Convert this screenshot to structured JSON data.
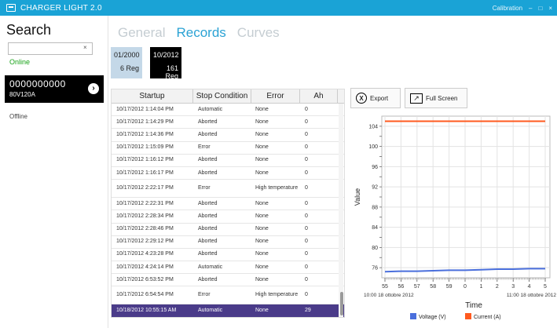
{
  "window": {
    "title": "CHARGER LIGHT 2.0",
    "right_label": "Calibration",
    "minimize": "–",
    "maximize": "□",
    "close": "×"
  },
  "sidebar": {
    "search_title": "Search",
    "search_value": "",
    "clear_glyph": "×",
    "online_label": "Online",
    "device": {
      "serial": "0000000000",
      "model": "80V120A",
      "arrow_glyph": "›"
    },
    "offline_label": "Offline"
  },
  "tabs": [
    {
      "label": "General",
      "active": false
    },
    {
      "label": "Records",
      "active": true
    },
    {
      "label": "Curves",
      "active": false
    }
  ],
  "registers": [
    {
      "date": "01/2000",
      "count": "6 Reg"
    },
    {
      "date": "10/2012",
      "count": "161 Reg"
    }
  ],
  "table": {
    "headers": [
      "Startup",
      "Stop Condition",
      "Error",
      "Ah"
    ],
    "rows": [
      [
        "10/17/2012 1:14:04 PM",
        "Automatic",
        "None",
        "0"
      ],
      [
        "10/17/2012 1:14:29 PM",
        "Aborted",
        "None",
        "0"
      ],
      [
        "10/17/2012 1:14:36 PM",
        "Aborted",
        "None",
        "0"
      ],
      [
        "10/17/2012 1:15:09 PM",
        "Error",
        "None",
        "0"
      ],
      [
        "10/17/2012 1:16:12 PM",
        "Aborted",
        "None",
        "0"
      ],
      [
        "10/17/2012 1:16:17 PM",
        "Aborted",
        "None",
        "0"
      ],
      [
        "10/17/2012 2:22:17 PM",
        "Error",
        "High temperature",
        "0"
      ],
      [
        "10/17/2012 2:22:31 PM",
        "Aborted",
        "None",
        "0"
      ],
      [
        "10/17/2012 2:28:34 PM",
        "Aborted",
        "None",
        "0"
      ],
      [
        "10/17/2012 2:28:46 PM",
        "Aborted",
        "None",
        "0"
      ],
      [
        "10/17/2012 2:29:12 PM",
        "Aborted",
        "None",
        "0"
      ],
      [
        "10/17/2012 4:23:28 PM",
        "Aborted",
        "None",
        "0"
      ],
      [
        "10/17/2012 4:24:14 PM",
        "Automatic",
        "None",
        "0"
      ],
      [
        "10/17/2012 6:53:52 PM",
        "Aborted",
        "None",
        "0"
      ],
      [
        "10/17/2012 6:54:54 PM",
        "Error",
        "High temperature",
        "0"
      ],
      [
        "10/18/2012 10:55:15 AM",
        "Automatic",
        "None",
        "29"
      ]
    ],
    "selected_index": 15
  },
  "buttons": {
    "export": "Export",
    "export_icon": "excel-icon",
    "full_screen": "Full Screen",
    "full_icon": "expand-icon"
  },
  "chart_data": {
    "type": "line",
    "xlabel": "Time",
    "ylabel": "Value",
    "ylim": [
      74,
      106
    ],
    "y_ticks": [
      76,
      78,
      80,
      82,
      84,
      86,
      88,
      90,
      92,
      94,
      96,
      98,
      100,
      102,
      104
    ],
    "y_tick_labels": [
      "76",
      "78",
      "80",
      "82",
      "84",
      "86",
      "88",
      "90",
      "92",
      "94",
      "96",
      "98",
      "100",
      "102",
      "104"
    ],
    "x_tick_labels": [
      "55",
      "56",
      "57",
      "58",
      "59",
      "0",
      "1",
      "2",
      "3",
      "4",
      "5"
    ],
    "x_date_labels": [
      "10:00 18 ottobre 2012",
      "11:00 18 ottobre 2012"
    ],
    "grid": true,
    "legend_position": "bottom",
    "series": [
      {
        "name": "Voltage (V)",
        "color": "#4a6fdc",
        "values": [
          75.2,
          75.3,
          75.3,
          75.4,
          75.5,
          75.5,
          75.6,
          75.7,
          75.7,
          75.8,
          75.8
        ]
      },
      {
        "name": "Current (A)",
        "color": "#ff5a1f",
        "values": [
          105,
          105,
          105,
          105,
          105,
          105,
          105,
          105,
          105,
          105,
          105
        ]
      }
    ]
  }
}
